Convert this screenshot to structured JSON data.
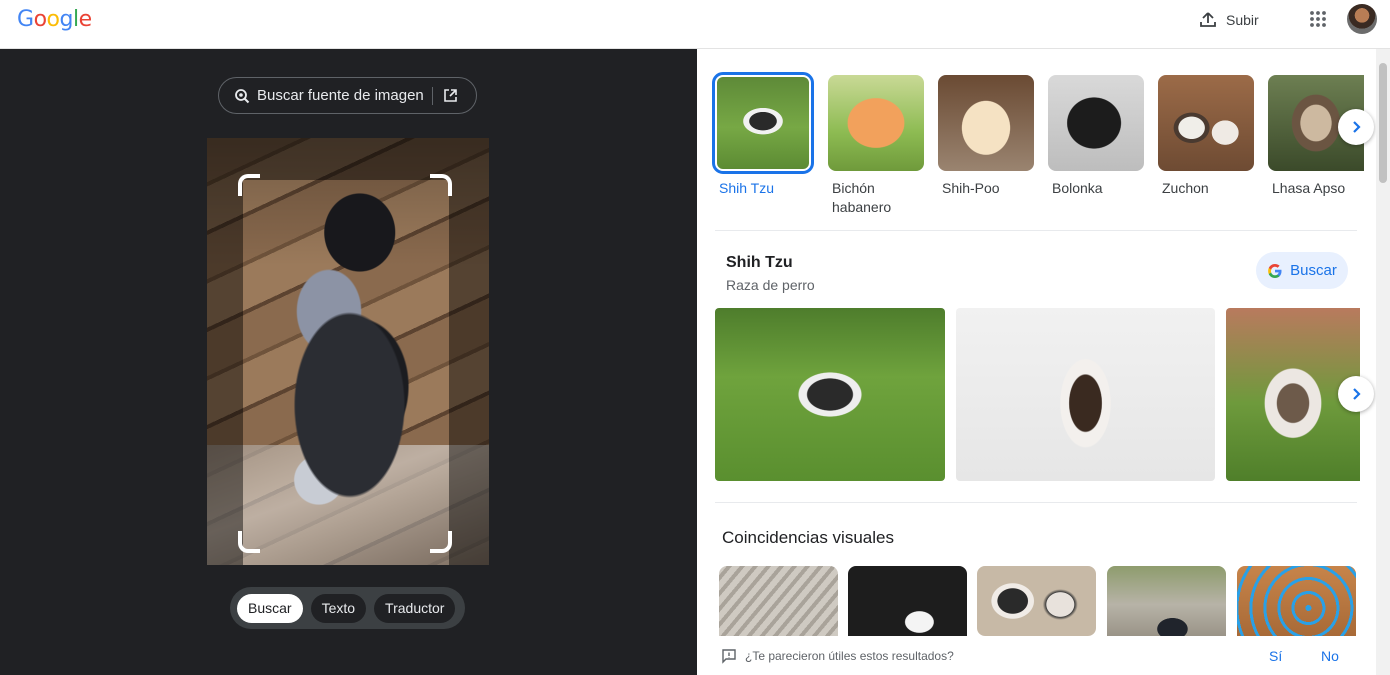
{
  "header": {
    "logo": [
      "G",
      "o",
      "o",
      "g",
      "l",
      "e"
    ],
    "logo_colors": [
      "#4285f4",
      "#ea4335",
      "#fbbc05",
      "#4285f4",
      "#34a853",
      "#ea4335"
    ],
    "upload_label": "Subir",
    "icons": {
      "upload": "upload-icon",
      "apps": "apps-grid-icon",
      "avatar": "avatar"
    }
  },
  "left": {
    "source_button": "Buscar fuente de imagen",
    "icons": {
      "lens": "lens-search-icon",
      "open": "open-external-icon"
    },
    "modes": [
      {
        "label": "Buscar",
        "active": true
      },
      {
        "label": "Texto",
        "active": false
      },
      {
        "label": "Traductor",
        "active": false
      }
    ]
  },
  "right": {
    "breeds": [
      {
        "name": "Shih Tzu",
        "selected": true
      },
      {
        "name": "Bichón habanero",
        "selected": false
      },
      {
        "name": "Shih-Poo",
        "selected": false
      },
      {
        "name": "Bolonka",
        "selected": false
      },
      {
        "name": "Zuchon",
        "selected": false
      },
      {
        "name": "Lhasa Apso",
        "selected": false
      }
    ],
    "entity": {
      "title": "Shih Tzu",
      "subtitle": "Raza de perro",
      "search_chip": "Buscar"
    },
    "visual_matches": {
      "title": "Coincidencias visuales"
    },
    "feedback": {
      "question": "¿Te parecieron útiles estos resultados?",
      "yes": "Sí",
      "no": "No"
    }
  },
  "colors": {
    "accent": "#1a73e8",
    "left_bg": "#202124",
    "mode_bar": "#3c4043"
  }
}
